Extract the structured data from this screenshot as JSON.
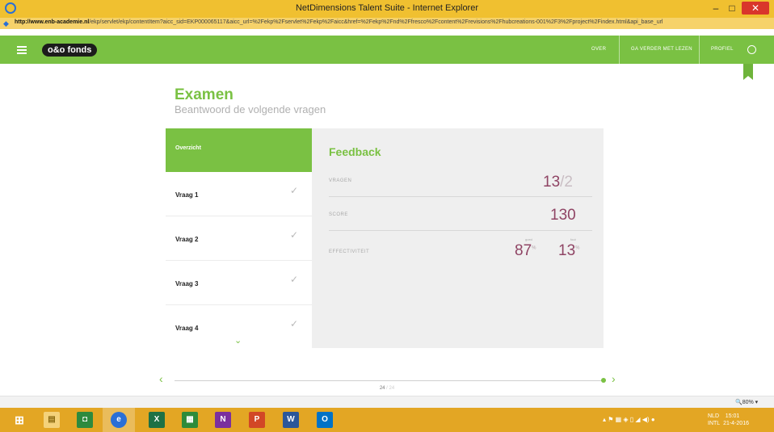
{
  "window": {
    "title": "NetDimensions Talent Suite - Internet Explorer",
    "min": "–",
    "max": "□",
    "close": "✕"
  },
  "address": {
    "host": "http://www.enb-academie.nl",
    "path": "/ekp/servlet/ekp/contentItem?aicc_sid=EKP000065117&aicc_url=%2Fekp%2Fservlet%2Fekp%2Faicc&href=%2Fekp%2Fnd%2Ffresco%2Fcontent%2Frevisions%2Fhubcreations-001%2F3%2Fproject%2Findex.html&api_base_url"
  },
  "appbar": {
    "logo": "o&o fonds",
    "nav": [
      "OVER",
      "GA VERDER MET LEZEN",
      "PROFIEL"
    ]
  },
  "exam": {
    "title": "Examen",
    "subtitle": "Beantwoord de volgende vragen"
  },
  "sidebar": {
    "overview": "Overzicht",
    "questions": [
      "Vraag 1",
      "Vraag 2",
      "Vraag 3",
      "Vraag 4"
    ],
    "check": "✓",
    "more": "⌄"
  },
  "feedback": {
    "title": "Feedback",
    "questions_label": "VRAGEN",
    "questions_value": "13",
    "questions_of": "/2",
    "score_label": "SCORE",
    "score_value": "130",
    "effect_label": "EFFECTIVITEIT",
    "good_label": "goed",
    "good_value": "87",
    "bad_label": "fout",
    "bad_value": "13",
    "pct": "%"
  },
  "pager": {
    "current": "24",
    "total": "/ 24",
    "prev": "‹",
    "next": "›"
  },
  "status": {
    "zoom": "🔍80%  ▾"
  },
  "taskbar": {
    "tray": "▴  ⚑  ▦  ◈  ▯  ◢  ◀)  ●",
    "lang": "NLD",
    "layout": "INTL",
    "time": "15:01",
    "date": "21-4-2016"
  },
  "colors": {
    "accent": "#7ac143",
    "value": "#8f4464",
    "taskbar": "#e3a624"
  }
}
